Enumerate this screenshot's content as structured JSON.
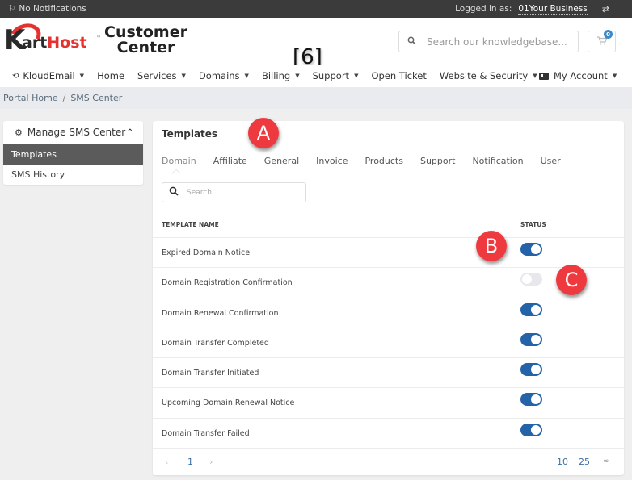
{
  "topbar": {
    "notifications": "No Notifications",
    "logged_in_label": "Logged in as:",
    "business": "01Your Business"
  },
  "header": {
    "logo_k": "K",
    "logo_art": "art",
    "logo_host": "Host",
    "logo_tm": "™",
    "logo_line1": "Customer",
    "logo_line2": "Center",
    "step_marker": "[6]",
    "search_placeholder": "Search our knowledgebase...",
    "cart_count": "0"
  },
  "nav": {
    "items": [
      {
        "label": "KloudEmail",
        "dropdown": true
      },
      {
        "label": "Home",
        "dropdown": false
      },
      {
        "label": "Services",
        "dropdown": true
      },
      {
        "label": "Domains",
        "dropdown": true
      },
      {
        "label": "Billing",
        "dropdown": true
      },
      {
        "label": "Support",
        "dropdown": true
      },
      {
        "label": "Open Ticket",
        "dropdown": false
      },
      {
        "label": "Website & Security",
        "dropdown": true
      }
    ],
    "account": "My Account"
  },
  "breadcrumb": {
    "home": "Portal Home",
    "separator": "/",
    "current": "SMS Center"
  },
  "sidebar": {
    "title": "Manage SMS Center",
    "items": [
      {
        "label": "Templates",
        "active": true
      },
      {
        "label": "SMS History",
        "active": false
      }
    ]
  },
  "panel": {
    "title": "Templates",
    "tabs": [
      "Domain",
      "Affiliate",
      "General",
      "Invoice",
      "Products",
      "Support",
      "Notification",
      "User"
    ],
    "active_tab": "Domain",
    "search_placeholder": "Search...",
    "columns": [
      "TEMPLATE NAME",
      "STATUS"
    ],
    "rows": [
      {
        "name": "Expired Domain Notice",
        "enabled": true
      },
      {
        "name": "Domain Registration Confirmation",
        "enabled": false
      },
      {
        "name": "Domain Renewal Confirmation",
        "enabled": true
      },
      {
        "name": "Domain Transfer Completed",
        "enabled": true
      },
      {
        "name": "Domain Transfer Initiated",
        "enabled": true
      },
      {
        "name": "Upcoming Domain Renewal Notice",
        "enabled": true
      },
      {
        "name": "Domain Transfer Failed",
        "enabled": true
      }
    ],
    "pagination": {
      "prev": "‹",
      "current_page": "1",
      "next": "›",
      "page_sizes": [
        "10",
        "25",
        "∞"
      ]
    }
  },
  "callouts": {
    "a": "A",
    "b": "B",
    "c": "C"
  },
  "colors": {
    "toggle_on": "#2563a9",
    "toggle_off": "#e6e8ec",
    "callout": "#ee3a3f",
    "brand_red": "#e63131",
    "sidebar_active": "#5b5b5b"
  }
}
